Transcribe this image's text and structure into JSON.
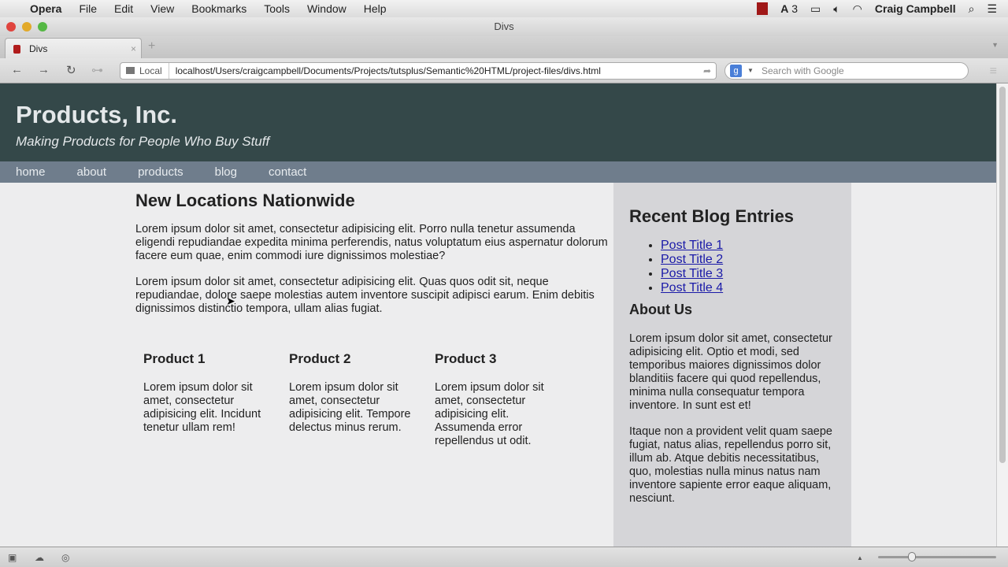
{
  "menubar": {
    "app": "Opera",
    "items": [
      "File",
      "Edit",
      "View",
      "Bookmarks",
      "Tools",
      "Window",
      "Help"
    ],
    "adobe_count": "3",
    "user": "Craig Campbell"
  },
  "window": {
    "title": "Divs"
  },
  "tab": {
    "label": "Divs"
  },
  "address": {
    "location_label": "Local",
    "url": "localhost/Users/craigcampbell/Documents/Projects/tutsplus/Semantic%20HTML/project-files/divs.html",
    "search_placeholder": "Search with Google"
  },
  "site": {
    "title": "Products, Inc.",
    "tagline": "Making Products for People Who Buy Stuff",
    "nav": [
      "home",
      "about",
      "products",
      "blog",
      "contact"
    ],
    "main": {
      "heading": "New Locations Nationwide",
      "paragraphs": [
        "Lorem ipsum dolor sit amet, consectetur adipisicing elit. Porro nulla tenetur assumenda eligendi repudiandae expedita minima perferendis, natus voluptatum eius aspernatur dolorum facere eum quae, enim commodi iure dignissimos molestiae?",
        "Lorem ipsum dolor sit amet, consectetur adipisicing elit. Quas quos odit sit, neque repudiandae, dolore saepe molestias autem inventore suscipit adipisci earum. Enim debitis dignissimos distinctio tempora, ullam alias fugiat."
      ],
      "products": [
        {
          "title": "Product 1",
          "text": "Lorem ipsum dolor sit amet, consectetur adipisicing elit. Incidunt tenetur ullam rem!"
        },
        {
          "title": "Product 2",
          "text": "Lorem ipsum dolor sit amet, consectetur adipisicing elit. Tempore delectus minus rerum."
        },
        {
          "title": "Product 3",
          "text": "Lorem ipsum dolor sit amet, consectetur adipisicing elit. Assumenda error repellendus ut odit."
        }
      ]
    },
    "sidebar": {
      "blog_heading": "Recent Blog Entries",
      "posts": [
        "Post Title 1",
        "Post Title 2",
        "Post Title 3",
        "Post Title 4"
      ],
      "about_heading": "About Us",
      "about_paragraphs": [
        "Lorem ipsum dolor sit amet, consectetur adipisicing elit. Optio et modi, sed temporibus maiores dignissimos dolor blanditiis facere qui quod repellendus, minima nulla consequatur tempora inventore. In sunt est et!",
        "Itaque non a provident velit quam saepe fugiat, natus alias, repellendus porro sit, illum ab. Atque debitis necessitatibus, quo, molestias nulla minus natus nam inventore sapiente error eaque aliquam, nesciunt."
      ]
    }
  }
}
